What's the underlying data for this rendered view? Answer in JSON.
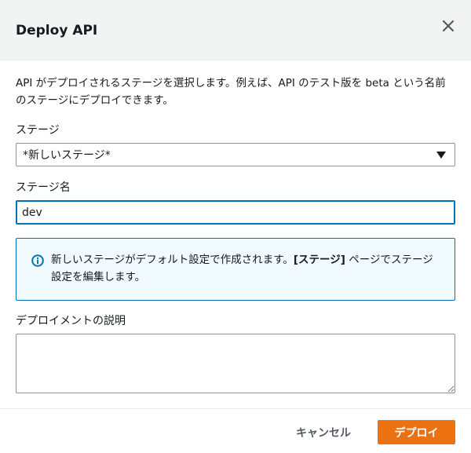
{
  "modal": {
    "title": "Deploy API",
    "close_icon": "close-icon",
    "description": "API がデプロイされるステージを選択します。例えば、API のテスト版を beta という名前のステージにデプロイできます。"
  },
  "stage": {
    "label": "ステージ",
    "selected": "*新しいステージ*",
    "caret_icon": "caret-down-icon"
  },
  "stage_name": {
    "label": "ステージ名",
    "value": "dev"
  },
  "info": {
    "icon": "info-icon",
    "text_before": "新しいステージがデフォルト設定で作成されます。",
    "text_bold": "[ステージ]",
    "text_after": " ページでステージ設定を編集します。"
  },
  "deployment_description": {
    "label": "デプロイメントの説明",
    "value": ""
  },
  "footer": {
    "cancel_label": "キャンセル",
    "deploy_label": "デプロイ"
  },
  "colors": {
    "primary": "#ec7211",
    "focus_border": "#0073bb",
    "info_background": "#f1faff",
    "header_background": "#f2f3f3"
  }
}
